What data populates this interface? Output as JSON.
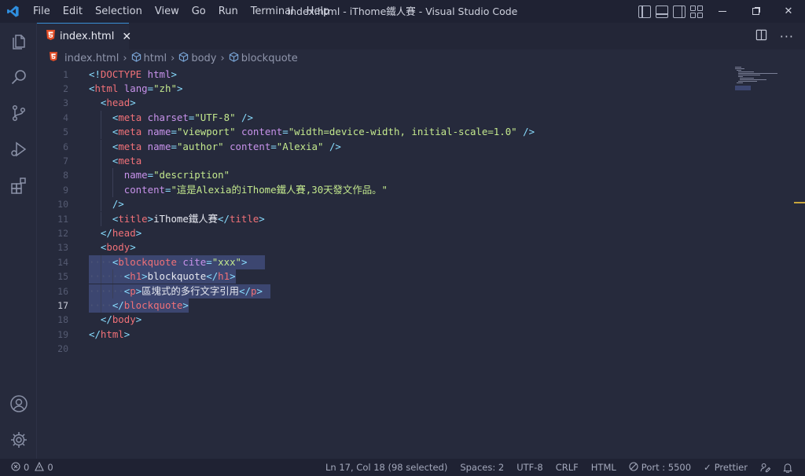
{
  "menu": [
    "File",
    "Edit",
    "Selection",
    "View",
    "Go",
    "Run",
    "Terminal",
    "Help"
  ],
  "window_title": "index.html - iThome鐵人賽 - Visual Studio Code",
  "tab": {
    "label": "index.html",
    "close": "✕"
  },
  "breadcrumb": [
    "index.html",
    "html",
    "body",
    "blockquote"
  ],
  "editor": {
    "active_line": 17,
    "lines": [
      [
        [
          "t-pun",
          "<!"
        ],
        [
          "t-dtn",
          "DOCTYPE"
        ],
        [
          "t-txt",
          " "
        ],
        [
          "t-dt",
          "html"
        ],
        [
          "t-pun",
          ">"
        ]
      ],
      [
        [
          "t-pun",
          "<"
        ],
        [
          "t-tag",
          "html"
        ],
        [
          "t-txt",
          " "
        ],
        [
          "t-attr",
          "lang"
        ],
        [
          "t-pun",
          "="
        ],
        [
          "t-str",
          "\"zh\""
        ],
        [
          "t-pun",
          ">"
        ]
      ],
      [
        [
          "t-txt",
          "  "
        ],
        [
          "t-pun",
          "<"
        ],
        [
          "t-tag",
          "head"
        ],
        [
          "t-pun",
          ">"
        ]
      ],
      [
        [
          "t-txt",
          "    "
        ],
        [
          "t-pun",
          "<"
        ],
        [
          "t-tag",
          "meta"
        ],
        [
          "t-txt",
          " "
        ],
        [
          "t-attr",
          "charset"
        ],
        [
          "t-pun",
          "="
        ],
        [
          "t-str",
          "\"UTF-8\""
        ],
        [
          "t-txt",
          " "
        ],
        [
          "t-pun",
          "/>"
        ]
      ],
      [
        [
          "t-txt",
          "    "
        ],
        [
          "t-pun",
          "<"
        ],
        [
          "t-tag",
          "meta"
        ],
        [
          "t-txt",
          " "
        ],
        [
          "t-attr",
          "name"
        ],
        [
          "t-pun",
          "="
        ],
        [
          "t-str",
          "\"viewport\""
        ],
        [
          "t-txt",
          " "
        ],
        [
          "t-attr",
          "content"
        ],
        [
          "t-pun",
          "="
        ],
        [
          "t-str",
          "\"width=device-width, initial-scale=1.0\""
        ],
        [
          "t-txt",
          " "
        ],
        [
          "t-pun",
          "/>"
        ]
      ],
      [
        [
          "t-txt",
          "    "
        ],
        [
          "t-pun",
          "<"
        ],
        [
          "t-tag",
          "meta"
        ],
        [
          "t-txt",
          " "
        ],
        [
          "t-attr",
          "name"
        ],
        [
          "t-pun",
          "="
        ],
        [
          "t-str",
          "\"author\""
        ],
        [
          "t-txt",
          " "
        ],
        [
          "t-attr",
          "content"
        ],
        [
          "t-pun",
          "="
        ],
        [
          "t-str",
          "\"Alexia\""
        ],
        [
          "t-txt",
          " "
        ],
        [
          "t-pun",
          "/>"
        ]
      ],
      [
        [
          "t-txt",
          "    "
        ],
        [
          "t-pun",
          "<"
        ],
        [
          "t-tag",
          "meta"
        ]
      ],
      [
        [
          "t-txt",
          "      "
        ],
        [
          "t-attr",
          "name"
        ],
        [
          "t-pun",
          "="
        ],
        [
          "t-str",
          "\"description\""
        ]
      ],
      [
        [
          "t-txt",
          "      "
        ],
        [
          "t-attr",
          "content"
        ],
        [
          "t-pun",
          "="
        ],
        [
          "t-str",
          "\"這是Alexia的iThome鐵人賽,30天發文作品。\""
        ]
      ],
      [
        [
          "t-txt",
          "    "
        ],
        [
          "t-pun",
          "/>"
        ]
      ],
      [
        [
          "t-txt",
          "    "
        ],
        [
          "t-pun",
          "<"
        ],
        [
          "t-tag",
          "title"
        ],
        [
          "t-pun",
          ">"
        ],
        [
          "t-txt",
          "iThome鐵人賽"
        ],
        [
          "t-pun",
          "</"
        ],
        [
          "t-tag",
          "title"
        ],
        [
          "t-pun",
          ">"
        ]
      ],
      [
        [
          "t-txt",
          "  "
        ],
        [
          "t-pun",
          "</"
        ],
        [
          "t-tag",
          "head"
        ],
        [
          "t-pun",
          ">"
        ]
      ],
      [
        [
          "t-txt",
          "  "
        ],
        [
          "t-pun",
          "<"
        ],
        [
          "t-tag",
          "body"
        ],
        [
          "t-pun",
          ">"
        ]
      ],
      [
        [
          "ws",
          "····"
        ],
        [
          "t-pun",
          "<"
        ],
        [
          "t-tag",
          "blockquote"
        ],
        [
          "ws",
          "·"
        ],
        [
          "t-attr",
          "cite"
        ],
        [
          "t-pun",
          "="
        ],
        [
          "t-str",
          "\"xxx\""
        ],
        [
          "t-pun",
          ">"
        ]
      ],
      [
        [
          "ws",
          "······"
        ],
        [
          "t-pun",
          "<"
        ],
        [
          "t-tag",
          "h1"
        ],
        [
          "t-pun",
          ">"
        ],
        [
          "t-txt",
          "blockquote"
        ],
        [
          "t-pun",
          "</"
        ],
        [
          "t-tag",
          "h1"
        ],
        [
          "t-pun",
          ">"
        ]
      ],
      [
        [
          "ws",
          "······"
        ],
        [
          "t-pun",
          "<"
        ],
        [
          "t-tag",
          "p"
        ],
        [
          "t-pun",
          ">"
        ],
        [
          "t-txt",
          "區塊式的多行文字引用"
        ],
        [
          "t-pun",
          "</"
        ],
        [
          "t-tag",
          "p"
        ],
        [
          "t-pun",
          ">"
        ]
      ],
      [
        [
          "ws",
          "····"
        ],
        [
          "t-pun",
          "</"
        ],
        [
          "t-tag",
          "blockquote"
        ],
        [
          "t-pun",
          ">"
        ]
      ],
      [
        [
          "t-txt",
          "  "
        ],
        [
          "t-pun",
          "</"
        ],
        [
          "t-tag",
          "body"
        ],
        [
          "t-pun",
          ">"
        ]
      ],
      [
        [
          "t-pun",
          "</"
        ],
        [
          "t-tag",
          "html"
        ],
        [
          "t-pun",
          ">"
        ]
      ],
      []
    ]
  },
  "statusbar": {
    "errors": "0",
    "warnings": "0",
    "position": "Ln 17, Col 18 (98 selected)",
    "spaces": "Spaces: 2",
    "encoding": "UTF-8",
    "eol": "CRLF",
    "language": "HTML",
    "port": "Port : 5500",
    "prettier": "Prettier"
  },
  "colors": {
    "accent": "#3a8fd6",
    "html_icon": "#e44d26",
    "selection": "#3c4670"
  }
}
